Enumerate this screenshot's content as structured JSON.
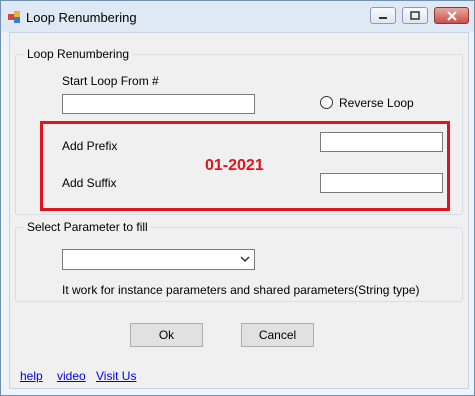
{
  "window": {
    "title": "Loop Renumbering"
  },
  "loop_group": {
    "legend": "Loop Renumbering",
    "start_label": "Start Loop From #",
    "start_value": "",
    "reverse_label": "Reverse Loop",
    "reverse_checked": false,
    "prefix_label": "Add Prefix",
    "prefix_value": "",
    "suffix_label": "Add Suffix",
    "suffix_value": "",
    "stamp_text": "01-2021",
    "highlight_color": "#e0141c"
  },
  "param_group": {
    "legend": "Select Parameter to fill",
    "selected_value": "",
    "note": "It work for instance parameters and shared parameters(String type)"
  },
  "buttons": {
    "ok": "Ok",
    "cancel": "Cancel"
  },
  "links": {
    "help": "help",
    "video": "video",
    "visit": "Visit Us"
  }
}
